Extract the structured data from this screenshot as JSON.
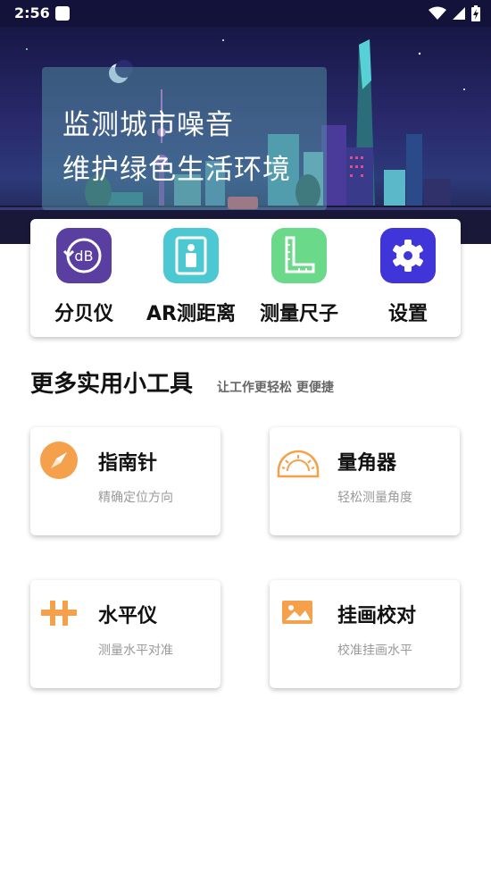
{
  "status_bar": {
    "time": "2:56",
    "icons": [
      "notification-square-icon",
      "wifi-icon",
      "signal-icon",
      "battery-charging-icon"
    ]
  },
  "banner": {
    "line1": "监测城市噪音",
    "line2": "维护绿色生活环境"
  },
  "quick_tools": [
    {
      "label": "分贝仪",
      "icon": "decibel-meter-icon",
      "icon_text": "dB",
      "color": "#5b3fa0"
    },
    {
      "label": "AR测距离",
      "icon": "ar-distance-icon",
      "color": "#4cc8d2"
    },
    {
      "label": "测量尺子",
      "icon": "ruler-icon",
      "color": "#6bd98a"
    },
    {
      "label": "设置",
      "icon": "gear-icon",
      "color": "#3f35d8"
    }
  ],
  "section": {
    "title": "更多实用小工具",
    "subtitle": "让工作更轻松 更便捷"
  },
  "tools": [
    {
      "title": "指南针",
      "desc": "精确定位方向",
      "icon": "compass-icon"
    },
    {
      "title": "量角器",
      "desc": "轻松测量角度",
      "icon": "protractor-icon"
    },
    {
      "title": "水平仪",
      "desc": "测量水平对准",
      "icon": "level-icon"
    },
    {
      "title": "挂画校对",
      "desc": "校准挂画水平",
      "icon": "picture-frame-icon"
    }
  ],
  "colors": {
    "accent_orange": "#f5a04a",
    "status_bar_bg": "#12123a"
  }
}
